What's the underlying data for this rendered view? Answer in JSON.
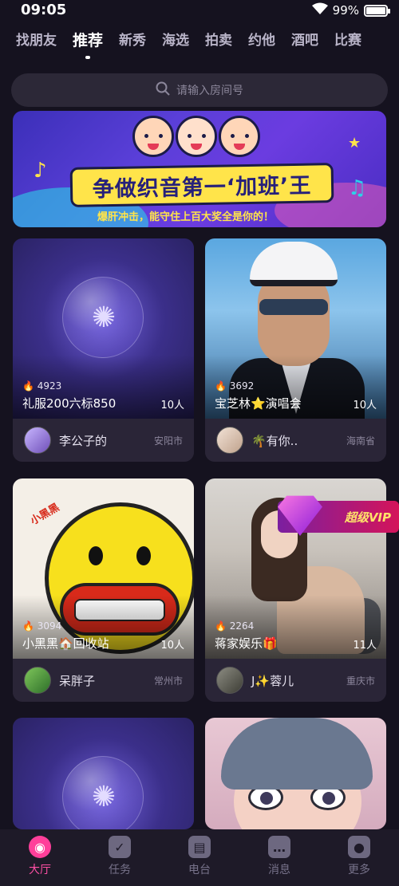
{
  "status_bar": {
    "time": "09:05",
    "battery": "99%",
    "battery_level": 0.99
  },
  "tabs": [
    {
      "label": "找朋友",
      "active": false
    },
    {
      "label": "推荐",
      "active": true
    },
    {
      "label": "新秀",
      "active": false
    },
    {
      "label": "海选",
      "active": false
    },
    {
      "label": "拍卖",
      "active": false
    },
    {
      "label": "约他",
      "active": false
    },
    {
      "label": "酒吧",
      "active": false
    },
    {
      "label": "比赛",
      "active": false
    }
  ],
  "search": {
    "placeholder": "请输入房间号",
    "icon": "search-icon"
  },
  "banner": {
    "title": "争做织音第一‘加班’王",
    "subtitle": "爆肝冲击，能守住上百大奖全是你的！"
  },
  "rooms": [
    {
      "heat": "4923",
      "title": "礼服200六标850",
      "count": "10人",
      "host": "李公子的",
      "city": "安阳市"
    },
    {
      "heat": "3692",
      "title": "宝芝林⭐演唱会",
      "count": "10人",
      "host": "🌴有你..",
      "city": "海南省"
    },
    {
      "heat": "3094",
      "title": "小黑黑🏠回收站",
      "count": "10人",
      "host": "呆胖子",
      "city": "常州市",
      "image_text": "小黑黑"
    },
    {
      "heat": "2264",
      "title": "蒋家娱乐🎁",
      "count": "11人",
      "host": "J✨蓉儿",
      "city": "重庆市",
      "badge": "超级VIP"
    }
  ],
  "bottom_nav": [
    {
      "label": "大厅",
      "icon": "hall-icon",
      "active": true
    },
    {
      "label": "任务",
      "icon": "task-icon",
      "active": false
    },
    {
      "label": "电台",
      "icon": "radio-icon",
      "active": false
    },
    {
      "label": "消息",
      "icon": "message-icon",
      "active": false
    },
    {
      "label": "更多",
      "icon": "profile-icon",
      "active": false
    }
  ],
  "colors": {
    "accent": "#ff3f9a",
    "background": "#15121f",
    "card_footer": "#2a2537"
  }
}
